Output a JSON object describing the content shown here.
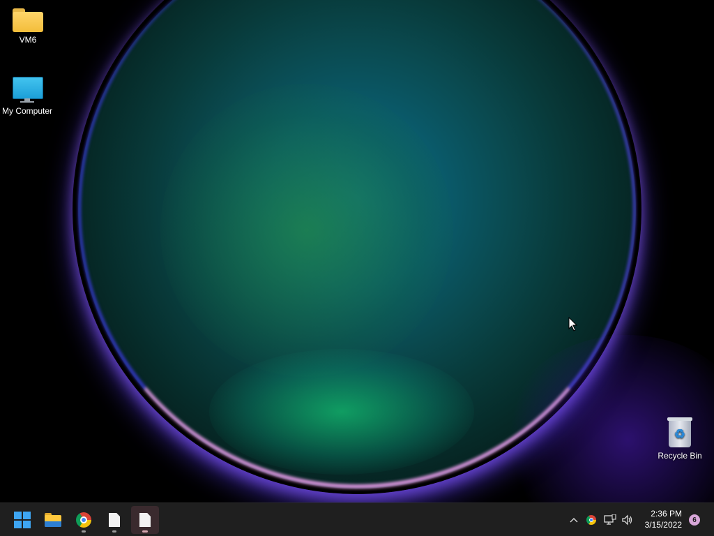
{
  "desktop": {
    "icons": [
      {
        "label": "VM6",
        "icon": "folder-icon"
      },
      {
        "label": "My Computer",
        "icon": "monitor-icon"
      },
      {
        "label": "Recycle Bin",
        "icon": "recycle-bin-icon"
      }
    ]
  },
  "taskbar": {
    "apps": [
      {
        "name": "start",
        "icon": "windows-logo-icon"
      },
      {
        "name": "file-explorer",
        "icon": "folder-icon",
        "running": false
      },
      {
        "name": "chrome",
        "icon": "chrome-icon",
        "running": true
      },
      {
        "name": "document",
        "icon": "document-icon",
        "running": true
      },
      {
        "name": "document-active",
        "icon": "document-icon",
        "running": true,
        "active": true
      }
    ],
    "tray": {
      "icons": [
        "chevron-up-icon",
        "chrome-icon",
        "network-icon",
        "volume-icon"
      ],
      "time": "2:36 PM",
      "date": "3/15/2022",
      "notification_count": "6"
    }
  },
  "colors": {
    "taskbar_bg": "#1f1f1f",
    "accent_blue": "#3ea6f3",
    "badge": "#d7a6d8"
  }
}
